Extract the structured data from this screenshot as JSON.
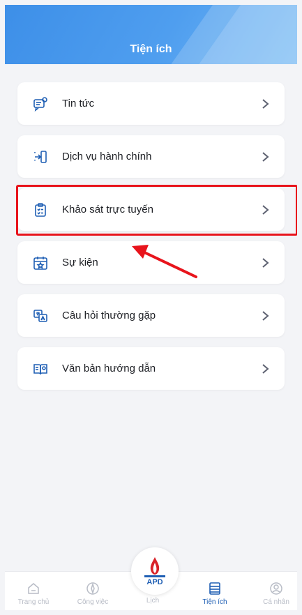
{
  "header": {
    "title": "Tiện ích"
  },
  "menu": {
    "items": [
      {
        "label": "Tin tức",
        "icon": "news-chat-icon"
      },
      {
        "label": "Dịch vụ hành chính",
        "icon": "login-door-icon"
      },
      {
        "label": "Khảo sát trực tuyến",
        "icon": "clipboard-survey-icon"
      },
      {
        "label": "Sự kiện",
        "icon": "calendar-star-icon"
      },
      {
        "label": "Câu hỏi thường gặp",
        "icon": "faq-translate-icon"
      },
      {
        "label": "Văn bản hướng dẫn",
        "icon": "book-guide-icon"
      }
    ]
  },
  "annotation": {
    "highlight_color": "#e8141c",
    "highlighted_item": "Khảo sát trực tuyến"
  },
  "bottom_nav": {
    "tabs": [
      {
        "label": "Trang chủ",
        "icon": "home-icon",
        "active": false
      },
      {
        "label": "Công việc",
        "icon": "compass-icon",
        "active": false
      },
      {
        "label": "Lịch",
        "icon": "calendar-icon",
        "active": false
      },
      {
        "label": "Tiện ích",
        "icon": "utilities-list-icon",
        "active": true
      },
      {
        "label": "Cá nhân",
        "icon": "user-icon",
        "active": false
      }
    ],
    "center_logo": {
      "text": "APD",
      "icon": "apd-logo-icon"
    }
  },
  "colors": {
    "accent": "#1f5fb4",
    "header_gradient_start": "#3d8fe8",
    "header_gradient_end": "#6fb6f3",
    "inactive": "#b8bcc6"
  }
}
